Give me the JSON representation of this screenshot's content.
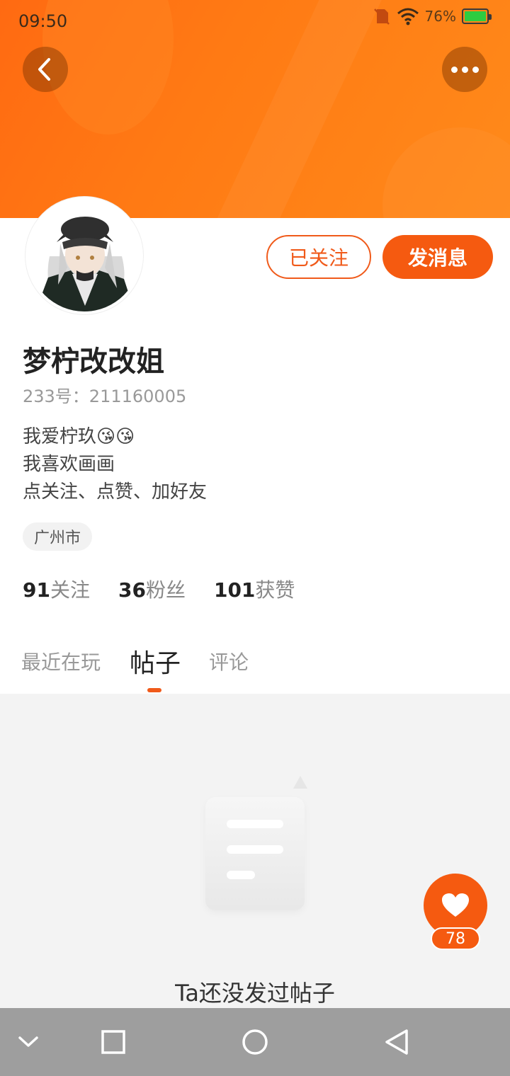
{
  "status_bar": {
    "time": "09:50",
    "battery_percent": "76%",
    "icons": [
      "no-sim-icon",
      "wifi-icon",
      "battery-icon"
    ]
  },
  "header": {
    "back_icon": "chevron-left-icon",
    "more_icon": "more-dots-icon",
    "colors": {
      "banner": "#ff7a14",
      "accent": "#f55a10"
    }
  },
  "profile": {
    "follow_label": "已关注",
    "message_label": "发消息",
    "name": "梦柠改改姐",
    "uid": "233号：211160005",
    "bio_lines": [
      "我爱柠玖😘😘",
      "我喜欢画画",
      "点关注、点赞、加好友"
    ],
    "location_tag": "广州市",
    "stats": [
      {
        "num": "91",
        "label": "关注"
      },
      {
        "num": "36",
        "label": "粉丝"
      },
      {
        "num": "101",
        "label": "获赞"
      }
    ]
  },
  "tabs": [
    {
      "label": "最近在玩",
      "active": false
    },
    {
      "label": "帖子",
      "active": true
    },
    {
      "label": "评论",
      "active": false
    }
  ],
  "empty_state": {
    "text": "Ta还没发过帖子",
    "icon": "empty-document-icon"
  },
  "like_fab": {
    "icon": "heart-icon",
    "count": "78"
  },
  "nav_bar": {
    "icons": [
      "chevron-down-icon",
      "square-icon",
      "circle-icon",
      "triangle-back-icon"
    ]
  }
}
